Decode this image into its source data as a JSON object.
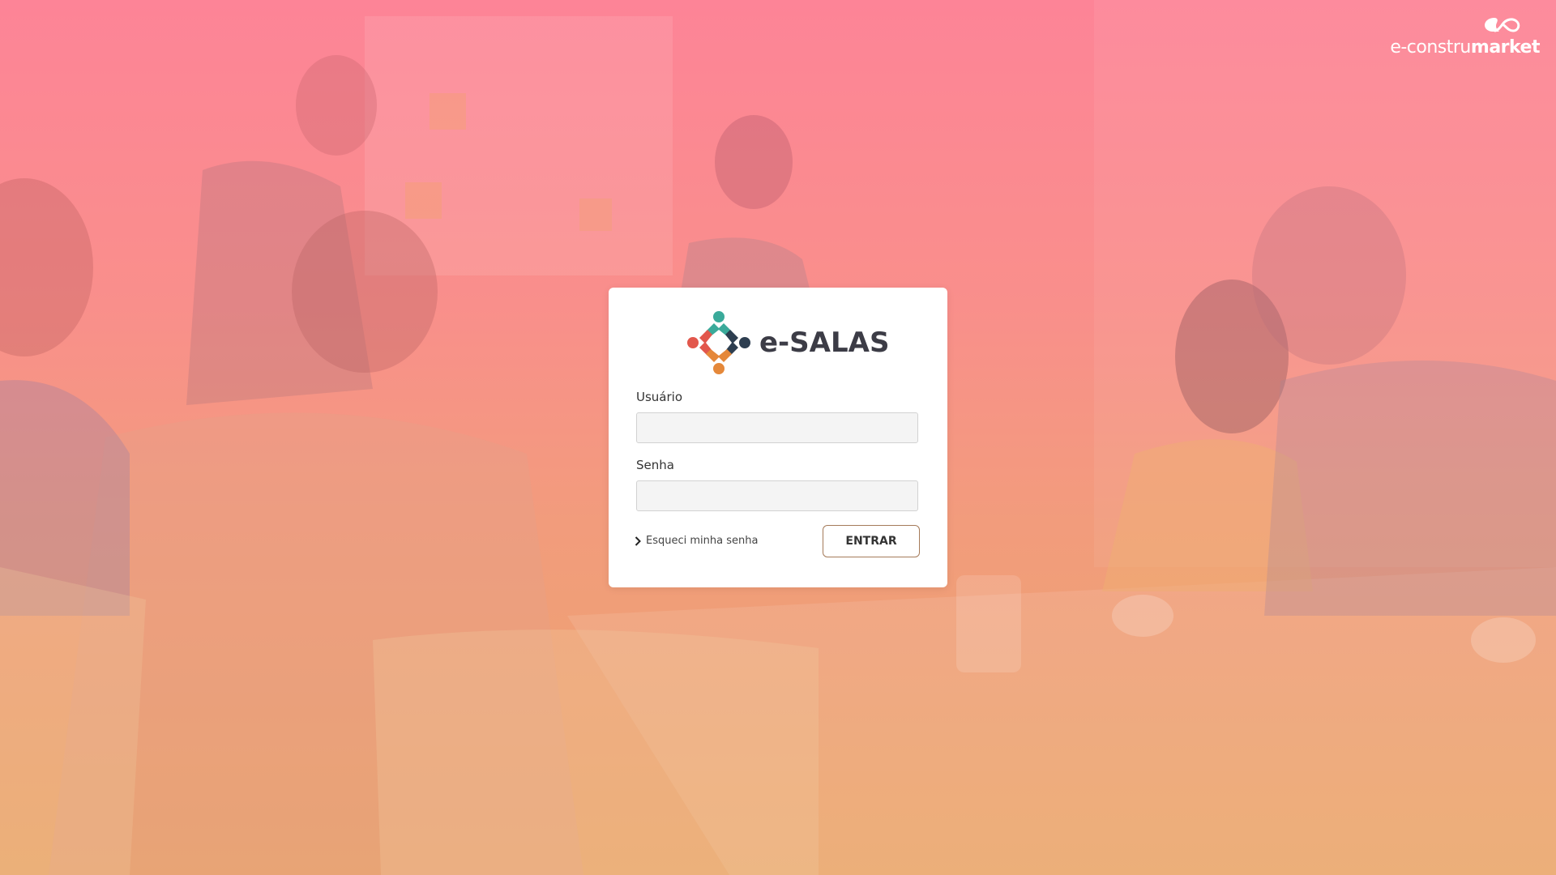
{
  "brand": {
    "logo_icon": "infinity-cloud-icon",
    "name_regular": "e-constru",
    "name_bold": "market"
  },
  "app": {
    "logo_icon": "people-cross-icon",
    "title": "e-SALAS"
  },
  "form": {
    "username_label": "Usuário",
    "username_value": "",
    "password_label": "Senha",
    "password_value": "",
    "forgot_link": "Esqueci minha senha",
    "forgot_icon": "chevron-right-icon",
    "submit_label": "ENTRAR"
  },
  "colors": {
    "gradient_top": "#fd8497",
    "gradient_bottom": "#eaa66a",
    "logo_teal": "#3aaa9a",
    "logo_red": "#e2574c",
    "logo_orange": "#e5883a",
    "logo_navy": "#2d3e50",
    "button_border": "#a57b5a"
  }
}
